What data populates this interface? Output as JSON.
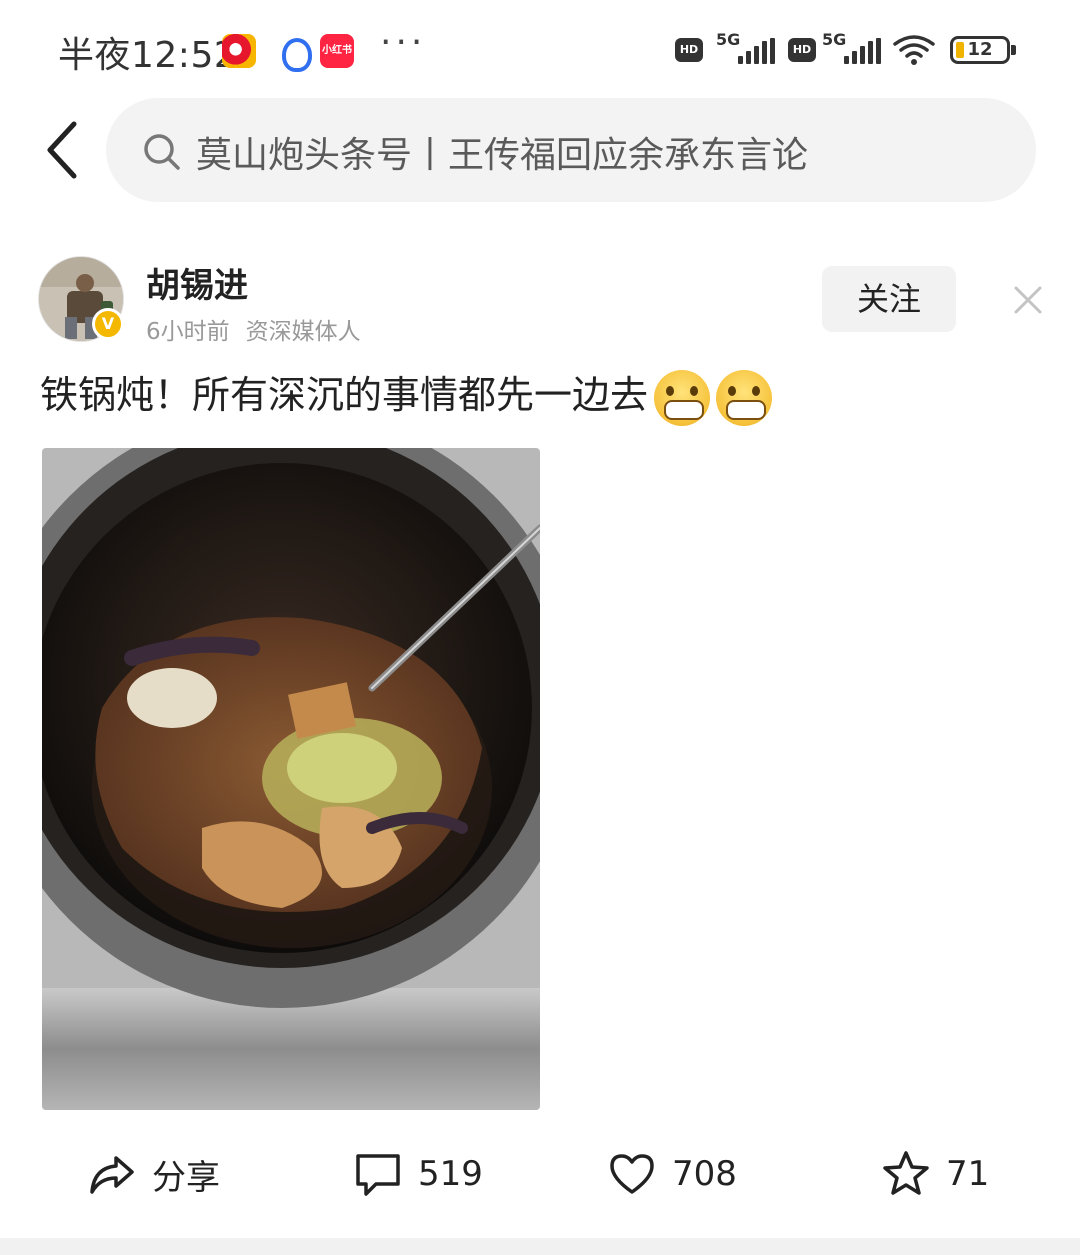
{
  "status_bar": {
    "time": "半夜12:52",
    "app_icons": [
      "weibo-icon",
      "baidu-icon",
      "xiaohongshu-icon"
    ],
    "xiaohongshu_label": "小红书",
    "more": "···",
    "sim1": {
      "hd": "HD",
      "network": "5G"
    },
    "sim2": {
      "hd": "HD",
      "network": "5G"
    },
    "battery": "12"
  },
  "header": {
    "back_icon": "chevron-left-icon",
    "search_placeholder": "莫山炮头条号丨王传福回应余承东言论"
  },
  "post": {
    "author": "胡锡进",
    "time_ago": "6小时前",
    "author_tag": "资深媒体人",
    "follow_label": "关注",
    "text": "铁锅炖！所有深沉的事情都先一边去",
    "emoji": [
      "grin-emoji",
      "grin-emoji"
    ]
  },
  "actions": {
    "share_label": "分享",
    "comment_count": "519",
    "like_count": "708",
    "favorite_count": "71"
  },
  "colors": {
    "accent_verify": "#f5b800",
    "search_bg": "#f3f3f3",
    "follow_bg": "#f2f2f2"
  }
}
